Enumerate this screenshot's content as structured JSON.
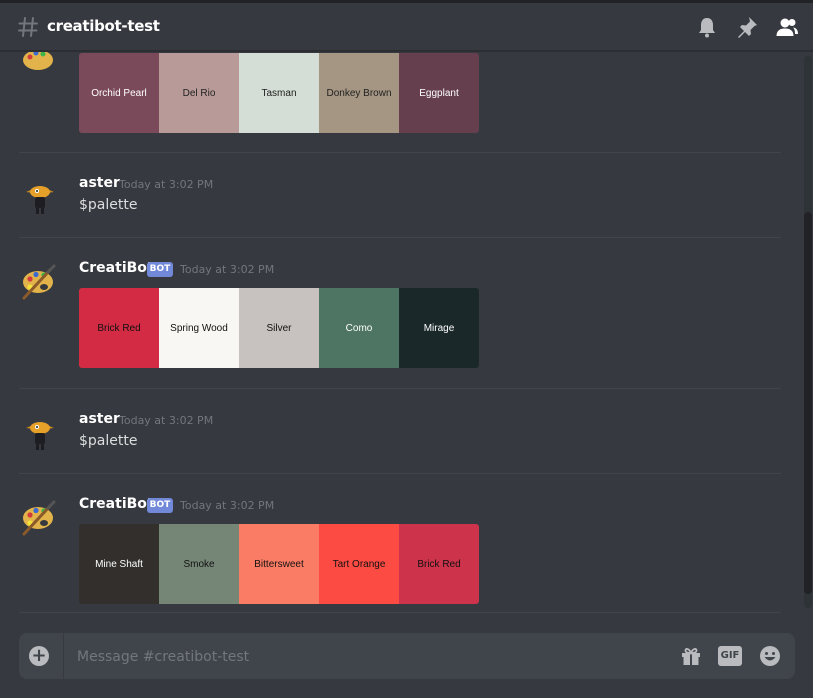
{
  "channel": {
    "name": "creatibot-test",
    "input_placeholder": "Message #creatibot-test",
    "gif_label": "GIF"
  },
  "messages": [
    {
      "palette": [
        {
          "name": "Orchid Pearl",
          "color": "#7b4a5a",
          "text_color": "#ffffff"
        },
        {
          "name": "Del Rio",
          "color": "#b89b98",
          "text_color": "#222222"
        },
        {
          "name": "Tasman",
          "color": "#d4ded6",
          "text_color": "#222222"
        },
        {
          "name": "Donkey Brown",
          "color": "#a59683",
          "text_color": "#222222"
        },
        {
          "name": "Eggplant",
          "color": "#653f4d",
          "text_color": "#ffffff"
        }
      ]
    },
    {
      "author": "aster",
      "timestamp": "Today at 3:02 PM",
      "content": "$palette"
    },
    {
      "author": "CreatiBot",
      "bot_tag": "BOT",
      "timestamp": "Today at 3:02 PM",
      "palette": [
        {
          "name": "Brick Red",
          "color": "#d22b43",
          "text_color": "#111111"
        },
        {
          "name": "Spring Wood",
          "color": "#f9f7f3",
          "text_color": "#111111"
        },
        {
          "name": "Silver",
          "color": "#c7c2bf",
          "text_color": "#111111"
        },
        {
          "name": "Como",
          "color": "#4e7563",
          "text_color": "#ffffff"
        },
        {
          "name": "Mirage",
          "color": "#1a2829",
          "text_color": "#ffffff"
        }
      ]
    },
    {
      "author": "aster",
      "timestamp": "Today at 3:02 PM",
      "content": "$palette"
    },
    {
      "author": "CreatiBot",
      "bot_tag": "BOT",
      "timestamp": "Today at 3:02 PM",
      "palette": [
        {
          "name": "Mine Shaft",
          "color": "#322f2d",
          "text_color": "#ffffff"
        },
        {
          "name": "Smoke",
          "color": "#758676",
          "text_color": "#111111"
        },
        {
          "name": "Bittersweet",
          "color": "#fb7c65",
          "text_color": "#111111"
        },
        {
          "name": "Tart Orange",
          "color": "#fc4b43",
          "text_color": "#111111"
        },
        {
          "name": "Brick Red",
          "color": "#cd334b",
          "text_color": "#111111"
        }
      ]
    }
  ]
}
